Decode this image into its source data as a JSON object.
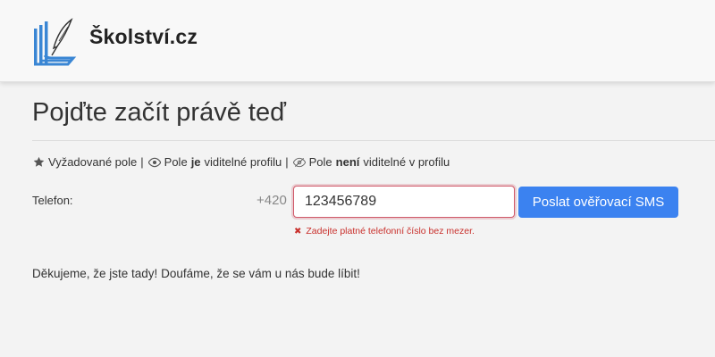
{
  "header": {
    "brand": "Školství.cz",
    "logo_icon": "books-quill-logo",
    "accent_color": "#3a86d4"
  },
  "main": {
    "title": "Pojďte začít právě teď",
    "legend": {
      "required_icon": "star-icon",
      "required_label": "Vyžadované pole",
      "separator": "|",
      "visible_icon": "eye-icon",
      "visible_prefix": "Pole",
      "visible_bold": "je",
      "visible_suffix": "viditelné profilu",
      "hidden_icon": "eye-slash-icon",
      "hidden_prefix": "Pole",
      "hidden_bold": "není",
      "hidden_suffix": "viditelné v profilu"
    },
    "phone": {
      "label": "Telefon:",
      "prefix": "+420",
      "value": "123456789",
      "error_icon": "x-icon",
      "error": "Zadejte platné telefonní číslo bez mezer.",
      "error_color": "#c9302c"
    },
    "sms_button": {
      "label": "Poslat ověřovací SMS",
      "color": "#3b82f0"
    },
    "thanks": "Děkujeme, že jste tady! Doufáme, že se vám u nás bude líbit!"
  }
}
